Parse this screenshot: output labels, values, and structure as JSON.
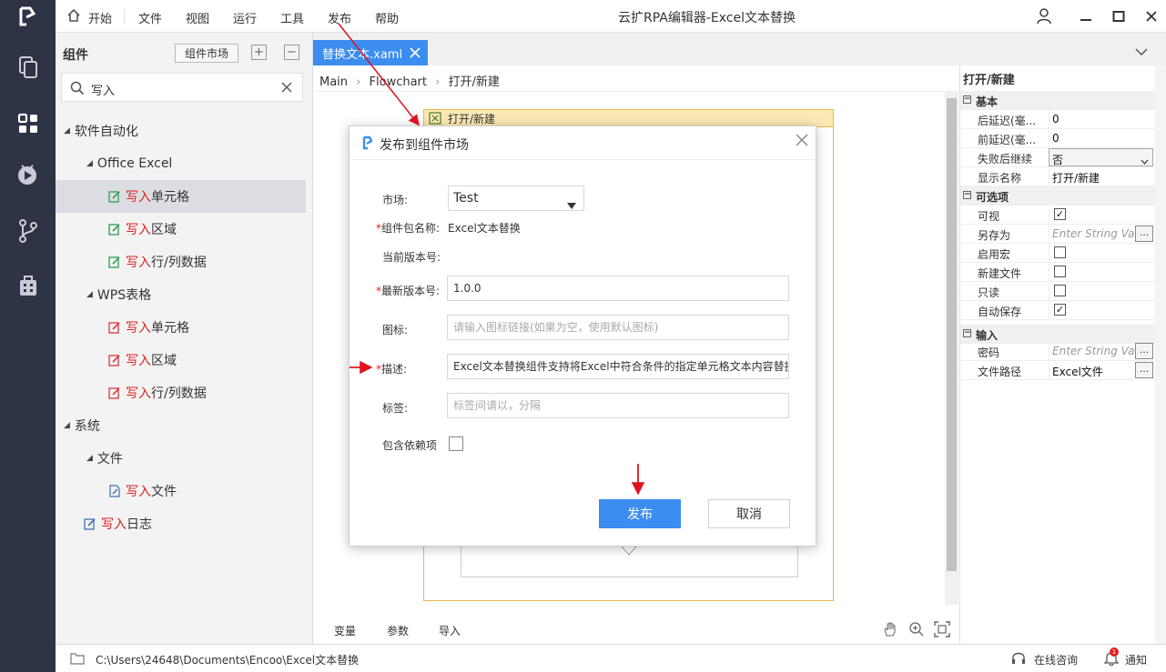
{
  "menubar": {
    "items": [
      "开始",
      "文件",
      "视图",
      "运行",
      "工具",
      "发布",
      "帮助"
    ],
    "window_title": "云扩RPA编辑器-Excel文本替换"
  },
  "components": {
    "title": "组件",
    "market_button": "组件市场",
    "expand_btn": "+",
    "collapse_btn": "−",
    "search_value": "写入",
    "tree": [
      {
        "label": "软件自动化"
      },
      {
        "label": "Office Excel"
      },
      {
        "hl": "写入",
        "rest": "单元格"
      },
      {
        "hl": "写入",
        "rest": "区域"
      },
      {
        "hl": "写入",
        "rest": "行/列数据"
      },
      {
        "label": "WPS表格"
      },
      {
        "hl": "写入",
        "rest": "单元格"
      },
      {
        "hl": "写入",
        "rest": "区域"
      },
      {
        "hl": "写入",
        "rest": "行/列数据"
      },
      {
        "label": "系统"
      },
      {
        "label": "文件"
      },
      {
        "hl": "写入",
        "rest": "文件"
      },
      {
        "hl": "写入",
        "rest": "日志"
      }
    ]
  },
  "designer": {
    "tab_label": "替换文本.xaml",
    "breadcrumb": [
      "Main",
      "Flowchart",
      "打开/新建"
    ],
    "activity_title": "打开/新建",
    "bottom_tabs": [
      "变量",
      "参数",
      "导入"
    ]
  },
  "properties": {
    "title": "打开/新建",
    "sections": [
      {
        "name": "基本"
      },
      {
        "name": "可选项"
      },
      {
        "name": "输入"
      }
    ],
    "delay_after_label": "后延迟(毫...",
    "delay_after": "0",
    "delay_before_label": "前延迟(毫...",
    "delay_before": "0",
    "continue_on_error_label": "失败后继续",
    "continue_on_error": "否",
    "display_name_label": "显示名称",
    "display_name": "打开/新建",
    "visible_label": "可视",
    "visible": true,
    "save_as_label": "另存为",
    "save_as_placeholder": "Enter String Valu",
    "enable_macro_label": "启用宏",
    "enable_macro": false,
    "new_file_label": "新建文件",
    "new_file": false,
    "readonly_label": "只读",
    "readonly": false,
    "autosave_label": "自动保存",
    "autosave": true,
    "password_label": "密码",
    "password_placeholder": "Enter String Valu",
    "file_path_label": "文件路径",
    "file_path": "Excel文件",
    "ellipsis": "...",
    "check": "✓"
  },
  "dialog": {
    "title": "发布到组件市场",
    "market_label": "市场:",
    "market_value": "Test",
    "package_label": "组件包名称:",
    "package_value": "Excel文本替换",
    "current_version_label": "当前版本号:",
    "latest_version_label": "最新版本号:",
    "latest_version_value": "1.0.0",
    "icon_label": "图标:",
    "icon_placeholder": "请输入图标链接(如果为空，使用默认图标)",
    "desc_label": "描述:",
    "desc_value": "Excel文本替换组件支持将Excel中符合条件的指定单元格文本内容替换",
    "tags_label": "标签:",
    "tags_placeholder": "标签间请以，分隔",
    "deps_label": "包含依赖项",
    "required_mark": "*",
    "publish_button": "发布",
    "cancel_button": "取消"
  },
  "statusbar": {
    "path": "C:\\Users\\24648\\Documents\\Encoo\\Excel文本替换",
    "online_consult": "在线咨询",
    "notify": "通知",
    "notify_badge": "1"
  },
  "colors": {
    "accent": "#3b8df0",
    "rail": "#2e3345",
    "highlight": "#e02020",
    "annotation_arrow": "#e0141e"
  }
}
